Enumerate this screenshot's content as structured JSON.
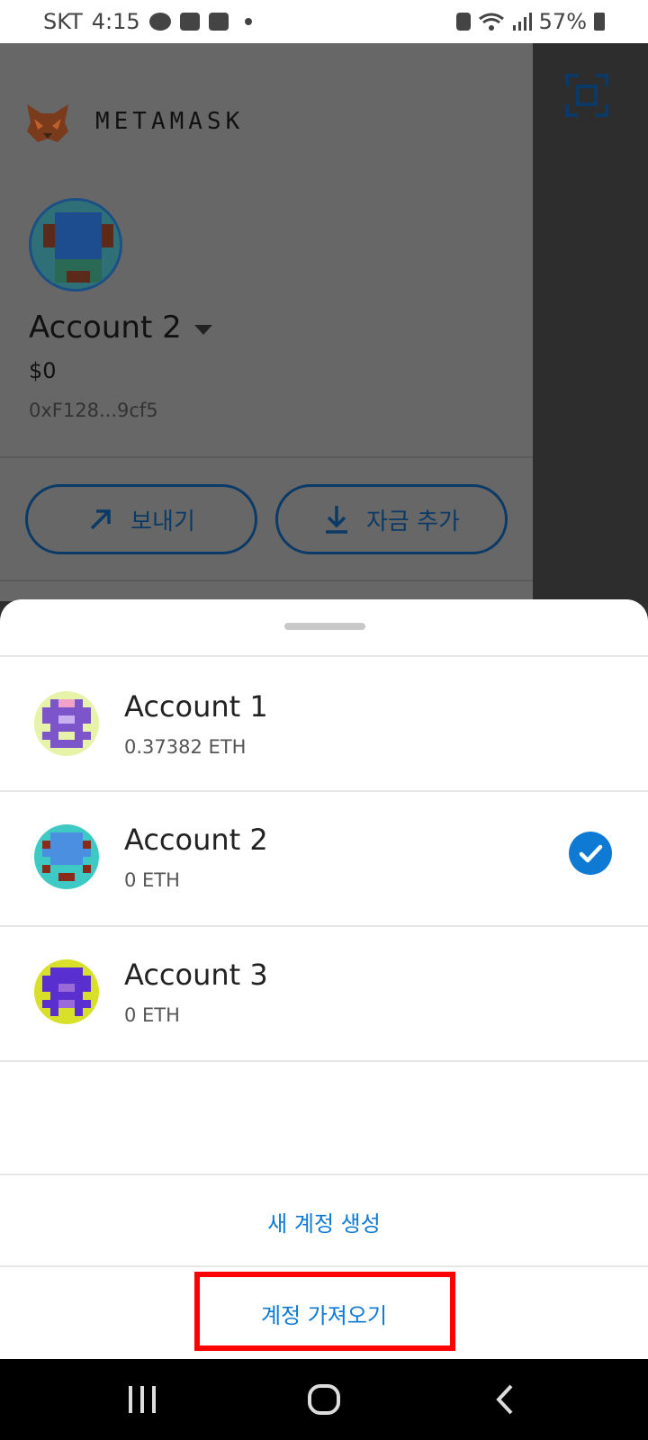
{
  "status_bar": {
    "carrier": "SKT",
    "time": "4:15",
    "battery": "57%"
  },
  "header": {
    "brand": "METAMASK"
  },
  "current_account": {
    "name": "Account 2",
    "fiat_balance": "$0",
    "address": "0xF128...9cf5"
  },
  "actions": {
    "send_label": "보내기",
    "add_funds_label": "자금 추가"
  },
  "account_list": [
    {
      "name": "Account 1",
      "balance": "0.37382 ETH",
      "selected": false
    },
    {
      "name": "Account 2",
      "balance": "0 ETH",
      "selected": true
    },
    {
      "name": "Account 3",
      "balance": "0 ETH",
      "selected": false
    }
  ],
  "sheet_actions": {
    "create_label": "새 계정 생성",
    "import_label": "계정 가져오기"
  },
  "colors": {
    "accent": "#0e7ad4",
    "highlight": "#ff0000",
    "overlay_gray": "#666766"
  },
  "icons": {
    "scan": "scan-icon",
    "send": "arrow-up-right-icon",
    "add_funds": "download-icon",
    "selected": "check-circle-icon",
    "nav_recent": "recent-apps-icon",
    "nav_home": "home-icon",
    "nav_back": "back-icon"
  }
}
